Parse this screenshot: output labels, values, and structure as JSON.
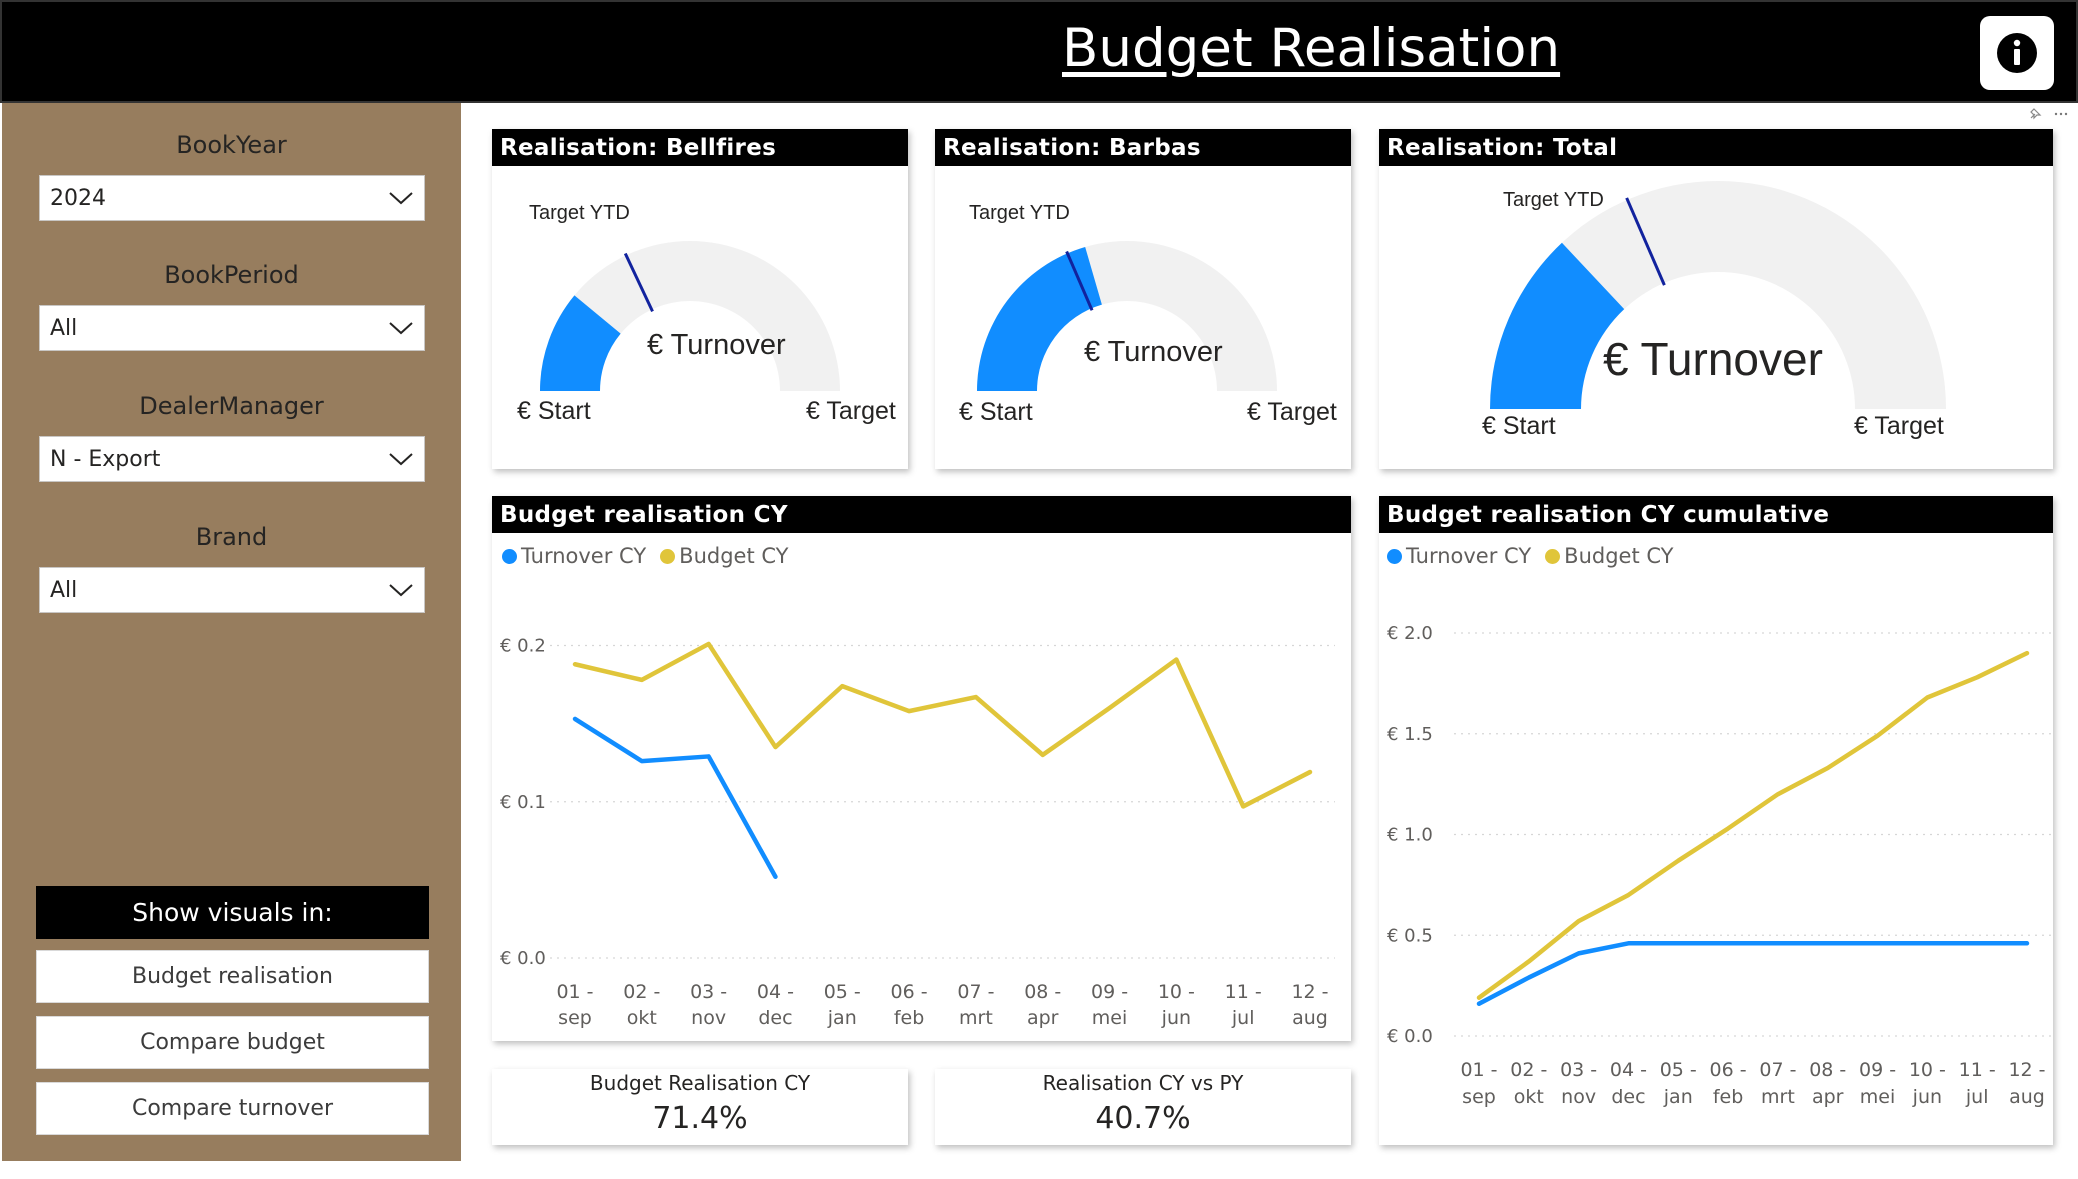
{
  "header": {
    "title": "Budget Realisation"
  },
  "filters": [
    {
      "label": "BookYear",
      "value": "2024"
    },
    {
      "label": "BookPeriod",
      "value": "All"
    },
    {
      "label": "DealerManager",
      "value": "N - Export"
    },
    {
      "label": "Brand",
      "value": "All"
    }
  ],
  "show_visuals": {
    "header": "Show visuals in:",
    "buttons": [
      "Budget realisation",
      "Compare budget",
      "Compare turnover"
    ]
  },
  "gauges": [
    {
      "title": "Realisation: Bellfires",
      "target_ytd_label": "Target YTD",
      "center_label": "€ Turnover",
      "start_label": "€ Start",
      "target_label": "€ Target",
      "fill_fraction": 0.22,
      "target_ytd_fraction": 0.36
    },
    {
      "title": "Realisation: Barbas",
      "target_ytd_label": "Target YTD",
      "center_label": "€ Turnover",
      "start_label": "€ Start",
      "target_label": "€ Target",
      "fill_fraction": 0.41,
      "target_ytd_fraction": 0.37
    },
    {
      "title": "Realisation: Total",
      "target_ytd_label": "Target YTD",
      "center_label": "€ Turnover",
      "start_label": "€ Start",
      "target_label": "€ Target",
      "fill_fraction": 0.26,
      "target_ytd_fraction": 0.37
    }
  ],
  "colors": {
    "turnover": "#118dff",
    "budget": "#e0c53a",
    "gauge_track": "#f1f1f1",
    "target_marker": "#12239e",
    "sidebar": "#977d5e"
  },
  "charts": {
    "monthly_title": "Budget realisation CY",
    "cumulative_title": "Budget realisation CY cumulative",
    "legend": [
      "Turnover CY",
      "Budget CY"
    ]
  },
  "kpis": [
    {
      "label": "Budget Realisation CY",
      "value": "71.4%"
    },
    {
      "label": "Realisation CY vs PY",
      "value": "40.7%"
    }
  ],
  "chart_data": [
    {
      "type": "line",
      "title": "Budget realisation CY",
      "xlabel": "",
      "ylabel": "",
      "categories": [
        [
          "01 -",
          "sep"
        ],
        [
          "02 -",
          "okt"
        ],
        [
          "03 -",
          "nov"
        ],
        [
          "04 -",
          "dec"
        ],
        [
          "05 -",
          "jan"
        ],
        [
          "06 -",
          "feb"
        ],
        [
          "07 -",
          "mrt"
        ],
        [
          "08 -",
          "apr"
        ],
        [
          "09 -",
          "mei"
        ],
        [
          "10 -",
          "jun"
        ],
        [
          "11 -",
          "jul"
        ],
        [
          "12 -",
          "aug"
        ]
      ],
      "yticks": [
        0.0,
        0.1,
        0.2
      ],
      "ytick_labels": [
        "€ 0.0",
        "€ 0.1",
        "€ 0.2"
      ],
      "ylim": [
        0,
        0.24
      ],
      "grid": true,
      "legend_position": "top-left",
      "series": [
        {
          "name": "Turnover CY",
          "values": [
            0.153,
            0.126,
            0.129,
            0.052,
            null,
            null,
            null,
            null,
            null,
            null,
            null,
            null
          ]
        },
        {
          "name": "Budget CY",
          "values": [
            0.188,
            0.178,
            0.201,
            0.135,
            0.174,
            0.158,
            0.167,
            0.13,
            0.16,
            0.191,
            0.097,
            0.119
          ]
        }
      ]
    },
    {
      "type": "line",
      "title": "Budget realisation CY cumulative",
      "xlabel": "",
      "ylabel": "",
      "categories": [
        [
          "01 -",
          "sep"
        ],
        [
          "02 -",
          "okt"
        ],
        [
          "03 -",
          "nov"
        ],
        [
          "04 -",
          "dec"
        ],
        [
          "05 -",
          "jan"
        ],
        [
          "06 -",
          "feb"
        ],
        [
          "07 -",
          "mrt"
        ],
        [
          "08 -",
          "apr"
        ],
        [
          "09 -",
          "mei"
        ],
        [
          "10 -",
          "jun"
        ],
        [
          "11 -",
          "jul"
        ],
        [
          "12 -",
          "aug"
        ]
      ],
      "yticks": [
        0.0,
        0.5,
        1.0,
        1.5,
        2.0
      ],
      "ytick_labels": [
        "€ 0.0",
        "€ 0.5",
        "€ 1.0",
        "€ 1.5",
        "€ 2.0"
      ],
      "ylim": [
        0,
        2.0
      ],
      "grid": true,
      "legend_position": "top-left",
      "series": [
        {
          "name": "Turnover CY",
          "values": [
            0.16,
            0.29,
            0.41,
            0.46,
            0.46,
            0.46,
            0.46,
            0.46,
            0.46,
            0.46,
            0.46,
            0.46
          ]
        },
        {
          "name": "Budget CY",
          "values": [
            0.19,
            0.37,
            0.57,
            0.7,
            0.87,
            1.03,
            1.2,
            1.33,
            1.49,
            1.68,
            1.78,
            1.9
          ]
        }
      ]
    }
  ]
}
